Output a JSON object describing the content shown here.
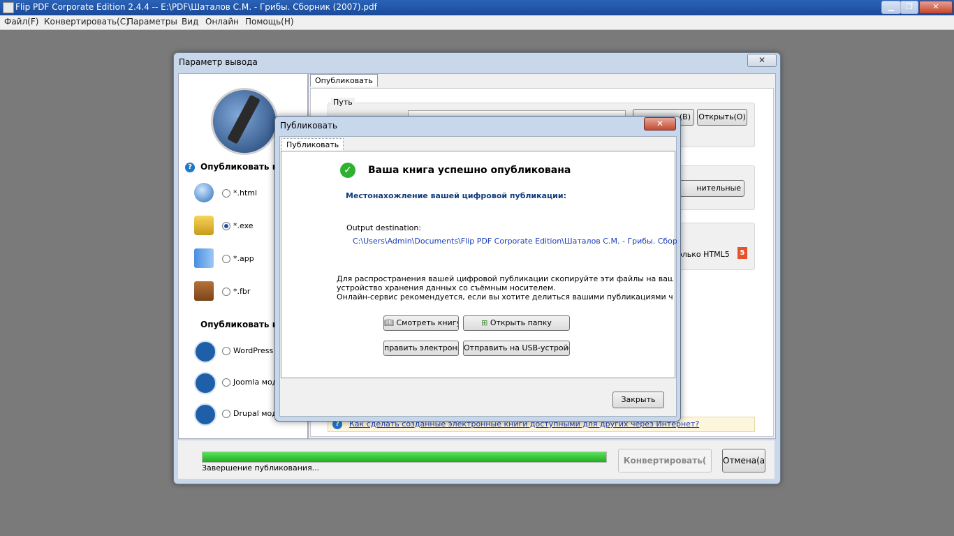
{
  "window": {
    "title": "Flip PDF Corporate Edition 2.4.4  -- E:\\PDF\\Шаталов С.М. - Грибы. Сборник (2007).pdf",
    "min_label": "▁",
    "max_label": "❐",
    "close_label": "✕"
  },
  "menu": {
    "file": "Файл(F)",
    "convert": "Конвертировать(C)",
    "params": "Параметры",
    "view": "Вид",
    "online": "Онлайн",
    "help": "Помощь(H)"
  },
  "output_dialog": {
    "title": "Параметр вывода",
    "close_label": "✕",
    "publish_as_heading": "Опубликовать ка",
    "publish_as_heading2": "Опубликовать ка",
    "formats": [
      {
        "label": "*.html",
        "selected": false,
        "icon": "globe-icon"
      },
      {
        "label": "*.exe",
        "selected": true,
        "icon": "lock-icon"
      },
      {
        "label": "*.app",
        "selected": false,
        "icon": "mac-finder-icon"
      },
      {
        "label": "*.fbr",
        "selected": false,
        "icon": "book-icon"
      }
    ],
    "plugins": [
      {
        "label": "WordPress П",
        "selected": false,
        "icon": "wordpress-icon"
      },
      {
        "label": "Joomla моду",
        "selected": false,
        "icon": "joomla-icon"
      },
      {
        "label": "Drupal моду",
        "selected": false,
        "icon": "drupal-icon"
      }
    ],
    "tab_label": "Опубликовать",
    "path_label": "Путь",
    "open_button": "Открыть(O)",
    "browse_button_partial": "(B)",
    "advanced_button_partial": "нительные",
    "html5_label": "олько HTML5",
    "html5_badge": "5",
    "help_link": "Как сделать созданные электронные книги доступными для других через Интернет?",
    "progress": 1.0,
    "status_text": "Завершение публикования...",
    "convert_button": "Конвертировать(",
    "cancel_button": "Отмена(а)"
  },
  "publish_dialog": {
    "title": "Публиковать",
    "close_label": "✕",
    "tab_label": "Публиковать",
    "success_title": "Ваша книга успешно опубликована",
    "location_heading": "Местонахожление вашей цифровой публикации:",
    "output_label": "Output destination:",
    "output_path": "C:\\Users\\Admin\\Documents\\Flip PDF Corporate Edition\\Шаталов С.М. - Грибы. Сбор",
    "info_line1": "Для распространения вашей цифровой публикации скопируйте эти файлы на ваш жесткий ди",
    "info_line2": "устройство хранения данных со съёмным носителем.",
    "info_line3": "Онлайн-сервис рекомендуется, если вы хотите делиться вашими публикациями через Интерне",
    "view_book_button": "Смотреть книгу",
    "open_folder_button": "Открыть папку",
    "send_email_button": "править электронное",
    "send_usb_button": "Отправить на USB-устройсте",
    "close_button": "Закрыть"
  }
}
